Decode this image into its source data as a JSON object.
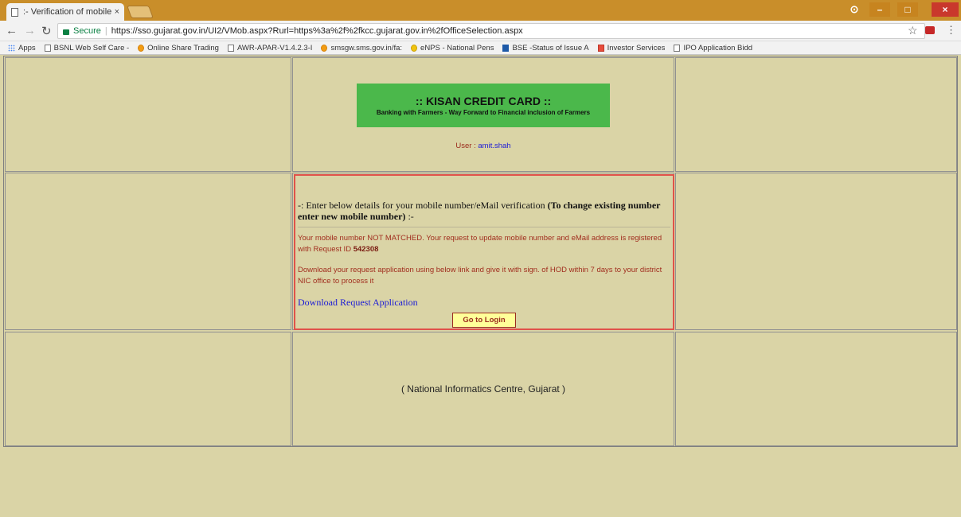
{
  "browser": {
    "tab_title": ":- Verification of mobile n",
    "tab_close": "×",
    "profile_icon": "⊙",
    "win_min": "–",
    "win_max": "□",
    "win_close": "×",
    "secure_label": "Secure",
    "separator": "|",
    "url": "https://sso.gujarat.gov.in/UI2/VMob.aspx?Rurl=https%3a%2f%2fkcc.gujarat.gov.in%2fOfficeSelection.aspx",
    "bookmarks": [
      {
        "label": "Apps",
        "icon": "apps-icon"
      },
      {
        "label": "BSNL Web Self Care -",
        "icon": "page-icon"
      },
      {
        "label": "Online Share Trading",
        "icon": "share-icon"
      },
      {
        "label": "AWR-APAR-V1.4.2.3-I",
        "icon": "page-icon"
      },
      {
        "label": "smsgw.sms.gov.in/fa:",
        "icon": "sms-icon"
      },
      {
        "label": "eNPS - National Pens",
        "icon": "enps-icon"
      },
      {
        "label": "BSE -Status of Issue A",
        "icon": "bse-icon"
      },
      {
        "label": "Investor Services",
        "icon": "investor-icon"
      },
      {
        "label": "IPO Application Bidd",
        "icon": "page-icon"
      }
    ]
  },
  "header": {
    "title": ":: KISAN CREDIT CARD ::",
    "subtitle": "Banking with Farmers - Way Forward to Financial inclusion of Farmers",
    "user_label": "User : ",
    "user_name": "amit.shah"
  },
  "verification": {
    "instruction_prefix": "-: Enter below details for your mobile number/eMail verification ",
    "instruction_bold": "(To change existing number enter new mobile number)",
    "instruction_suffix": " :-",
    "message_line": "Your mobile number NOT MATCHED. Your request to update mobile number and eMail address is registered with Request ID ",
    "request_id": "542308",
    "download_message": "Download your request application using below link and give it with sign. of HOD within 7 days to your district NIC office to process it",
    "download_link": "Download Request Application",
    "login_button": "Go to Login"
  },
  "footer": {
    "text": "( National Informatics Centre, Gujarat )"
  },
  "colors": {
    "page_bg": "#dad4a6",
    "banner_bg": "#4bb84b",
    "panel_border": "#e0524a",
    "link": "#1a1ad6",
    "message": "#a12e1f"
  }
}
